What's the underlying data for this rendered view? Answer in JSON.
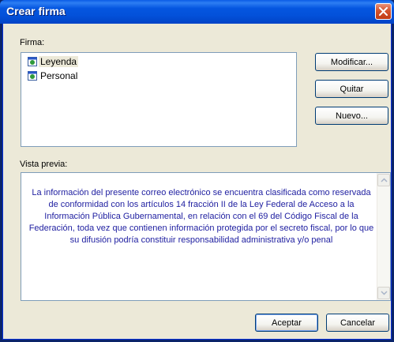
{
  "window": {
    "title": "Crear firma"
  },
  "firma": {
    "label": "Firma:",
    "items": [
      {
        "label": "Leyenda",
        "selected": true
      },
      {
        "label": "Personal",
        "selected": false
      }
    ]
  },
  "buttons": {
    "modificar": "Modificar...",
    "quitar": "Quitar",
    "nuevo": "Nuevo...",
    "aceptar": "Aceptar",
    "cancelar": "Cancelar"
  },
  "preview": {
    "label": "Vista previa:",
    "text": "La información del presente correo electrónico se encuentra clasificada como reservada de conformidad con los artículos 14 fracción II de la Ley Federal de Acceso a la Información Pública Gubernamental, en relación  con el 69 del Código Fiscal de la Federación, toda vez que contienen información protegida por el secreto fiscal, por lo que su difusión podría constituir responsabilidad administrativa y/o penal"
  },
  "colors": {
    "titlebar": "#0351da",
    "preview_text": "#1e1ea0",
    "dialog_bg": "#ece9d8"
  }
}
